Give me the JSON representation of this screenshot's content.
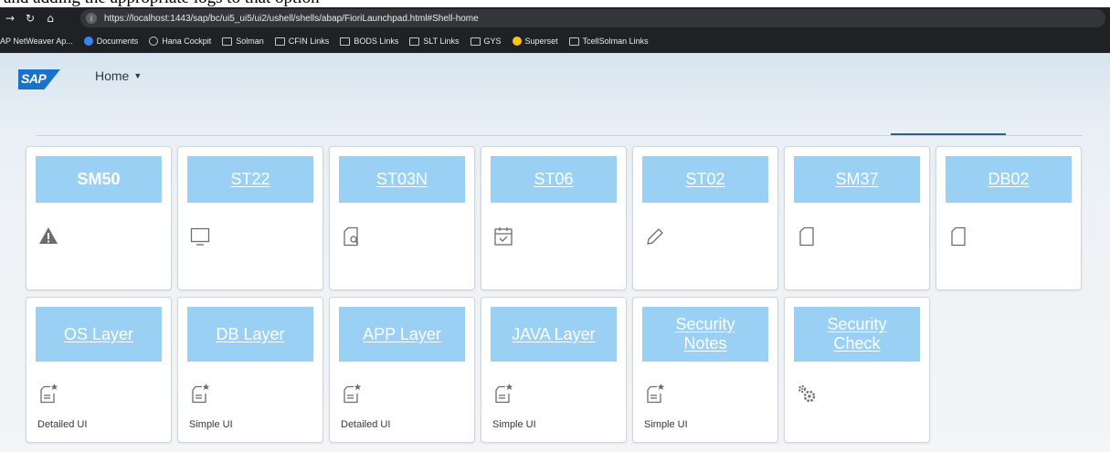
{
  "browser": {
    "url": "https://localhost:1443/sap/bc/ui5_ui5/ui2/ushell/shells/abap/FioriLaunchpad.html#Shell-home",
    "bookmarks": [
      "AP NetWeaver Ap...",
      "Documents",
      "Hana Cockpit",
      "Solman",
      "CFIN Links",
      "BODS Links",
      "SLT Links",
      "GYS",
      "Superset",
      "TcellSolman Links"
    ]
  },
  "shell": {
    "logo": "SAP",
    "home_label": "Home"
  },
  "tiles_row1": [
    {
      "title": "SM50",
      "icon": "alert-icon",
      "info": ""
    },
    {
      "title": "ST22",
      "icon": "monitor-icon",
      "info": ""
    },
    {
      "title": "ST03N",
      "icon": "document-search-icon",
      "info": ""
    },
    {
      "title": "ST06",
      "icon": "calendar-icon",
      "info": ""
    },
    {
      "title": "ST02",
      "icon": "pencil-icon",
      "info": ""
    },
    {
      "title": "SM37",
      "icon": "document-icon",
      "info": ""
    },
    {
      "title": "DB02",
      "icon": "document-icon",
      "info": ""
    }
  ],
  "tiles_row2": [
    {
      "title": "OS Layer",
      "icon": "favorite-document-icon",
      "info": "Detailed UI"
    },
    {
      "title": "DB Layer",
      "icon": "favorite-document-icon",
      "info": "Simple UI"
    },
    {
      "title": "APP Layer",
      "icon": "favorite-document-icon",
      "info": "Detailed UI"
    },
    {
      "title": "JAVA Layer",
      "icon": "favorite-document-icon",
      "info": "Simple UI"
    },
    {
      "title": "Security Notes",
      "icon": "favorite-document-icon",
      "info": "Simple UI"
    },
    {
      "title": "Security Check",
      "icon": "gears-icon",
      "info": ""
    }
  ]
}
